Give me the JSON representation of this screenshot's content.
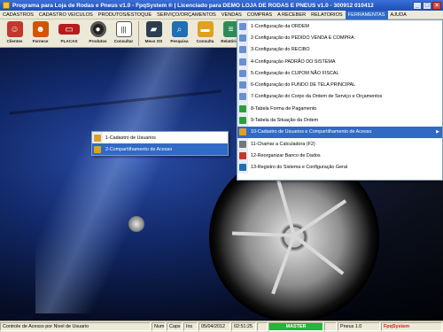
{
  "window": {
    "title": "Programa para Loja de Rodas e Pneus v1.0 - FpqSystem ® | Licenciado para  DEMO LOJA DE RODAS E PNEUS v1.0 - 300912 010412",
    "buttons": [
      "_",
      "□",
      "×"
    ]
  },
  "menubar": [
    {
      "label": "CADASTROS"
    },
    {
      "label": "CADASTRO VEICULOS"
    },
    {
      "label": "PRODUTOS/ESTOQUE"
    },
    {
      "label": "SERVIÇO/ORÇAMENTOS"
    },
    {
      "label": "VENDAS"
    },
    {
      "label": "COMPRAS"
    },
    {
      "label": "A RECEBER"
    },
    {
      "label": "RELATORIOS"
    },
    {
      "label": "FERRAMENTAS"
    },
    {
      "label": "AJUDA"
    }
  ],
  "toolbar": [
    {
      "label": "Clientes",
      "icon": "person-icon",
      "color": "#c0392b"
    },
    {
      "label": "Fornece",
      "icon": "supplier-icon",
      "color": "#d35400"
    },
    {
      "label": "PLACAS",
      "icon": "plate-icon",
      "color": "#b71c1c"
    },
    {
      "label": "Produtos",
      "icon": "tire-icon",
      "color": "#222222"
    },
    {
      "label": "Consultar",
      "icon": "barcode-icon",
      "color": "#555555"
    },
    {
      "label": "Meus OS",
      "icon": "car-icon",
      "color": "#2c3e50"
    },
    {
      "label": "Pesquisa",
      "icon": "search-icon",
      "color": "#1f6fb2"
    },
    {
      "label": "Consulta",
      "icon": "folder-icon",
      "color": "#e0a020"
    },
    {
      "label": "Relatórios",
      "icon": "report-icon",
      "color": "#2e8b57"
    }
  ],
  "dropdown": [
    {
      "label": "1-Configuração da ORDEM",
      "icon_color": "#6a8fd0"
    },
    {
      "label": "2-Configuração do PEDIDO VENDA E COMPRA",
      "icon_color": "#6a8fd0"
    },
    {
      "label": "3-Configuração do RECIBO",
      "icon_color": "#6a8fd0"
    },
    {
      "label": "4-Configuração PADRÃO DO SISTEMA",
      "icon_color": "#6a8fd0"
    },
    {
      "label": "5-Configuração do CUPOM NÃO FISCAL",
      "icon_color": "#6a8fd0"
    },
    {
      "label": "6-Configuração do FUNDO DE TELA PRINCIPAL",
      "icon_color": "#6a8fd0"
    },
    {
      "label": "7-Configuração do Corpo da Ordem de Serviço e Orçamentos",
      "icon_color": "#6a8fd0"
    },
    {
      "label": "8-Tabela Forma de Pagamento",
      "icon_color": "#2e9d3a"
    },
    {
      "label": "9-Tabela da Situação da Ordem",
      "icon_color": "#2e9d3a"
    },
    {
      "label": "10-Cadastro de Usuarios e Compartilhamento de Acesso",
      "icon_color": "#e0a020",
      "highlight": true,
      "has_submenu": true
    },
    {
      "label": "11-Chamar a Calculadora (F2)",
      "icon_color": "#777777"
    },
    {
      "label": "12-Reorganizar Banco de Dados",
      "icon_color": "#c0392b"
    },
    {
      "label": "13-Registro do Sistema e Configuração Geral",
      "icon_color": "#1f6fb2"
    }
  ],
  "submenu": [
    {
      "label": "1-Cadastro de Usuarios",
      "icon_color": "#e0a020"
    },
    {
      "label": "2-Compartilhamento de Acesso",
      "icon_color": "#e0a020",
      "highlight": true
    }
  ],
  "statusbar": {
    "message": "Controle de Acesso por Nivel de Usuario",
    "num": "Num",
    "caps": "Caps",
    "ins": "Ins",
    "date": "05/04/2012",
    "time": "02:51:25",
    "master": "MASTER",
    "version": "Pneus 1.0",
    "brand": "FpqSystem"
  }
}
